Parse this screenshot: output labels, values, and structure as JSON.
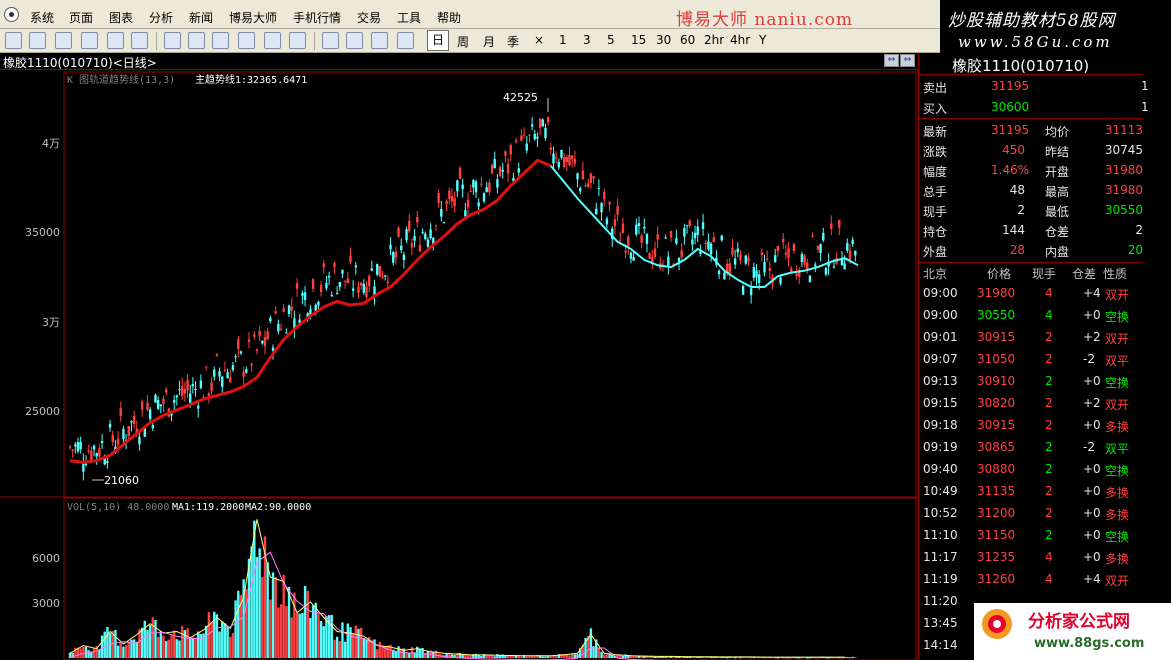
{
  "menu": [
    "系统",
    "页面",
    "图表",
    "分析",
    "新闻",
    "博易大师",
    "手机行情",
    "交易",
    "工具",
    "帮助"
  ],
  "brand_text": "博易大师 naniu.com",
  "banner": {
    "top": "炒股辅助教材58股网",
    "bottom": "www.58Gu.com"
  },
  "periods": [
    "日",
    "周",
    "月",
    "季",
    "×",
    "1",
    "3",
    "5",
    "15",
    "30",
    "60",
    "2hr",
    "4hr",
    "Y"
  ],
  "chart": {
    "title": "橡胶1110(010710)<日线>",
    "indicator_label": "K 图轨道趋势线(13,3)",
    "indicator_value": "主趋势线1:32365.6471",
    "high_label": "42525",
    "low_label": "21060",
    "vol_label": "VOL(5,10) 48.0000",
    "ma1_label": "MA1:119.2000",
    "ma2_label": "MA2:90.0000",
    "y_ticks": [
      "4万",
      "35000",
      "3万",
      "25000"
    ],
    "vol_ticks": [
      "6000",
      "3000"
    ]
  },
  "chart_data": {
    "type": "candlestick",
    "title": "橡胶1110(010710)<日线>",
    "price_axis": {
      "ticks": [
        40000,
        35000,
        30000,
        25000
      ],
      "tick_labels": [
        "4万",
        "35000",
        "3万",
        "25000"
      ],
      "range": [
        20000,
        43500
      ]
    },
    "volume_axis": {
      "ticks": [
        6000,
        3000
      ],
      "range": [
        0,
        9500
      ]
    },
    "annotations": [
      {
        "label": "42525",
        "value": 42525
      },
      {
        "label": "21060",
        "value": 21060
      }
    ],
    "trend_values": [
      21900,
      21800,
      21900,
      22200,
      22800,
      23400,
      24000,
      24400,
      24700,
      25000,
      25300,
      25500,
      25700,
      26000,
      26500,
      27600,
      28600,
      29300,
      29900,
      30400,
      30700,
      30500,
      30600,
      31100,
      31500,
      32200,
      33000,
      33700,
      34300,
      35000,
      35500,
      35800,
      36300,
      37100,
      37800,
      38500,
      38200,
      37300,
      36400,
      35600,
      34800,
      34000,
      33600,
      33000,
      32700,
      32600,
      33000,
      33600,
      33200,
      32400,
      31900,
      31500,
      31500,
      32100,
      32300,
      32400,
      32600,
      32900,
      33100,
      32700
    ],
    "volume_values": [
      300,
      800,
      600,
      1700,
      900,
      1500,
      2200,
      1600,
      1700,
      1300,
      1800,
      2600,
      1900,
      3900,
      8900,
      5200,
      4900,
      2900,
      3600,
      2600,
      1700,
      1600,
      1400,
      800,
      700,
      500,
      600,
      400,
      300,
      250,
      200,
      200,
      180,
      160,
      150,
      140,
      150,
      200,
      300,
      1500,
      300,
      200,
      150,
      120,
      100,
      100,
      90,
      80,
      80,
      70,
      70,
      70,
      60,
      60,
      60,
      60,
      60,
      60,
      60,
      48
    ]
  },
  "quote": {
    "symbol": "橡胶1110(010710)",
    "sell": {
      "label": "卖出",
      "price": "31195",
      "qty": "1"
    },
    "buy": {
      "label": "买入",
      "price": "30600",
      "qty": "1"
    },
    "stats": [
      {
        "l1": "最新",
        "v1": "31195",
        "c1": "red",
        "l2": "均价",
        "v2": "31113",
        "c2": "red"
      },
      {
        "l1": "涨跌",
        "v1": "450",
        "c1": "red",
        "l2": "昨结",
        "v2": "30745",
        "c2": "white"
      },
      {
        "l1": "幅度",
        "v1": "1.46%",
        "c1": "red",
        "l2": "开盘",
        "v2": "31980",
        "c2": "red"
      },
      {
        "l1": "总手",
        "v1": "48",
        "c1": "white",
        "l2": "最高",
        "v2": "31980",
        "c2": "red"
      },
      {
        "l1": "现手",
        "v1": "2",
        "c1": "white",
        "l2": "最低",
        "v2": "30550",
        "c2": "green"
      },
      {
        "l1": "持仓",
        "v1": "144",
        "c1": "white",
        "l2": "仓差",
        "v2": "2",
        "c2": "white"
      },
      {
        "l1": "外盘",
        "v1": "28",
        "c1": "red",
        "l2": "内盘",
        "v2": "20",
        "c2": "green"
      }
    ],
    "tick_headers": [
      "北京",
      "价格",
      "现手",
      "仓差",
      "性质"
    ],
    "ticks": [
      {
        "time": "09:00",
        "price": "31980",
        "pc": "red",
        "vol": "4",
        "vc": "red",
        "oi": "+4",
        "nat": "双开",
        "nc": "red"
      },
      {
        "time": "09:00",
        "price": "30550",
        "pc": "green",
        "vol": "4",
        "vc": "green",
        "oi": "+0",
        "nat": "空换",
        "nc": "green"
      },
      {
        "time": "09:01",
        "price": "30915",
        "pc": "red",
        "vol": "2",
        "vc": "red",
        "oi": "+2",
        "nat": "双开",
        "nc": "red"
      },
      {
        "time": "09:07",
        "price": "31050",
        "pc": "red",
        "vol": "2",
        "vc": "red",
        "oi": "-2",
        "nat": "双平",
        "nc": "red"
      },
      {
        "time": "09:13",
        "price": "30910",
        "pc": "red",
        "vol": "2",
        "vc": "green",
        "oi": "+0",
        "nat": "空换",
        "nc": "green"
      },
      {
        "time": "09:15",
        "price": "30820",
        "pc": "red",
        "vol": "2",
        "vc": "red",
        "oi": "+2",
        "nat": "双开",
        "nc": "red"
      },
      {
        "time": "09:18",
        "price": "30915",
        "pc": "red",
        "vol": "2",
        "vc": "red",
        "oi": "+0",
        "nat": "多换",
        "nc": "red"
      },
      {
        "time": "09:19",
        "price": "30865",
        "pc": "red",
        "vol": "2",
        "vc": "green",
        "oi": "-2",
        "nat": "双平",
        "nc": "green"
      },
      {
        "time": "09:40",
        "price": "30880",
        "pc": "red",
        "vol": "2",
        "vc": "green",
        "oi": "+0",
        "nat": "空换",
        "nc": "green"
      },
      {
        "time": "10:49",
        "price": "31135",
        "pc": "red",
        "vol": "2",
        "vc": "red",
        "oi": "+0",
        "nat": "多换",
        "nc": "red"
      },
      {
        "time": "10:52",
        "price": "31200",
        "pc": "red",
        "vol": "2",
        "vc": "red",
        "oi": "+0",
        "nat": "多换",
        "nc": "red"
      },
      {
        "time": "11:10",
        "price": "31150",
        "pc": "red",
        "vol": "2",
        "vc": "green",
        "oi": "+0",
        "nat": "空换",
        "nc": "green"
      },
      {
        "time": "11:17",
        "price": "31235",
        "pc": "red",
        "vol": "4",
        "vc": "red",
        "oi": "+0",
        "nat": "多换",
        "nc": "red"
      },
      {
        "time": "11:19",
        "price": "31260",
        "pc": "red",
        "vol": "4",
        "vc": "red",
        "oi": "+4",
        "nat": "双开",
        "nc": "red"
      },
      {
        "time": "11:20",
        "price": "",
        "pc": "red",
        "vol": "",
        "vc": "red",
        "oi": "",
        "nat": "",
        "nc": "red"
      },
      {
        "time": "13:45",
        "price": "",
        "pc": "red",
        "vol": "",
        "vc": "red",
        "oi": "",
        "nat": "",
        "nc": "red"
      },
      {
        "time": "14:14",
        "price": "",
        "pc": "red",
        "vol": "",
        "vc": "red",
        "oi": "",
        "nat": "",
        "nc": "red"
      }
    ]
  },
  "ad": {
    "title": "分析家公式网",
    "url": "www.88gs.com"
  },
  "colors": {
    "up": "#ff4040",
    "down": "#54ffff",
    "trend": "#e01010",
    "ma1": "#ffff80",
    "ma2": "#ff80ff"
  }
}
